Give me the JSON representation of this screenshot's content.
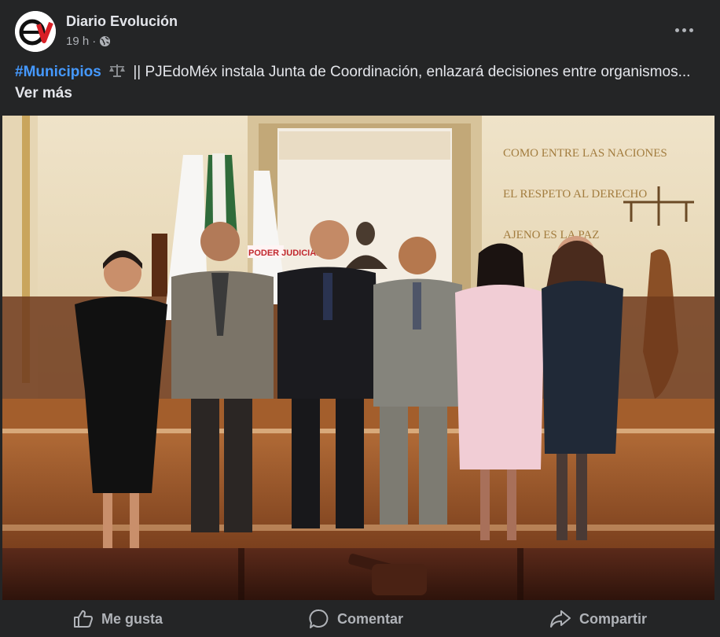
{
  "post": {
    "page_name": "Diario Evolución",
    "time": "19 h",
    "separator": "·",
    "privacy_icon": "globe-icon",
    "more_icon": "more-options-icon",
    "avatar_logo_text": "ev"
  },
  "caption": {
    "hashtag": "#Municipios",
    "emoji_icon": "scales-icon",
    "text": "|| PJEdoMéx instala Junta de Coordinación, enlazará decisiones entre organismos...",
    "see_more": "Ver más"
  },
  "photo": {
    "wall_text_lines": [
      "COMO ENTRE LAS NACIONES",
      "EL RESPETO AL DERECHO",
      "AJENO ES LA PAZ"
    ],
    "banner_text": "PODER JUDICIAL"
  },
  "actions": {
    "like": "Me gusta",
    "comment": "Comentar",
    "share": "Compartir"
  },
  "colors": {
    "background": "#242526",
    "text_primary": "#e4e6eb",
    "text_secondary": "#b0b3b8",
    "hashtag": "#4599ff",
    "logo_red": "#d81f26"
  }
}
